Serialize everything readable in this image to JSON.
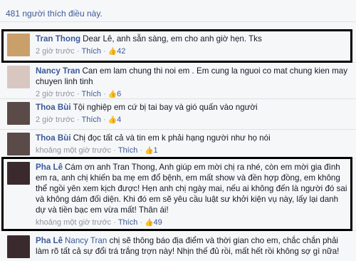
{
  "likes_summary": "481 người thích điều này.",
  "comments": [
    {
      "author": "Tran Thong",
      "text": "Dear Lê, anh sẵn sàng, em cho anh giờ hẹn. Tks",
      "time": "2 giờ trước",
      "like_label": "Thích",
      "like_count": "42",
      "avatar_color": "#c9a06a"
    },
    {
      "author": "Nancy Tran",
      "text": "Can em lam chung thi noi em . Em cung la nguoi co mat chung kien may chuyen linh tinh",
      "time": "2 giờ trước",
      "like_label": "Thích",
      "like_count": "6",
      "avatar_color": "#d8c7c0"
    },
    {
      "author": "Thoa Bùi",
      "text": "Tội nghiệp em cứ bị tai bay và gió quấn vào người",
      "time": "2 giờ trước",
      "like_label": "Thích",
      "like_count": "4",
      "avatar_color": "#5a4a48"
    },
    {
      "author": "Thoa Bùi",
      "text": "Chị đọc tất cả và tin em k phải hạng người như họ nói",
      "time": "khoảng một giờ trước",
      "like_label": "Thích",
      "like_count": "1",
      "avatar_color": "#5a4a48"
    },
    {
      "author": "Pha Lê",
      "text": "Cám ơn anh Tran Thong, Anh giúp em mời chị ra nhé, còn em mời gia đình em ra, anh chị khiến ba mẹ em đổ bệnh, em mất show và đền hợp đồng, em không thể ngồi yên xem kịch được! Hẹn anh chị ngày mai, nếu ai không đến là người đó sai và không dám đối diện. Khi đó em sẽ yêu cầu luật sư khởi kiện vụ này, lấy lại danh dự và tiền bạc em vừa mất! Thân ái!",
      "time": "khoảng một giờ trước",
      "like_label": "Thích",
      "like_count": "49",
      "avatar_color": "#3a2a2e"
    },
    {
      "author": "Pha Lê",
      "mention": "Nancy Tran",
      "text": " chị sẽ thông báo địa điểm và thời gian cho em, chắc chắn phải làm rõ tất cả sự đổi trá trắng trợn này! Nhịn thế đủ rồi, mất hết rồi không sợ gì nữa!",
      "time": "",
      "avatar_color": "#3a2a2e"
    }
  ]
}
